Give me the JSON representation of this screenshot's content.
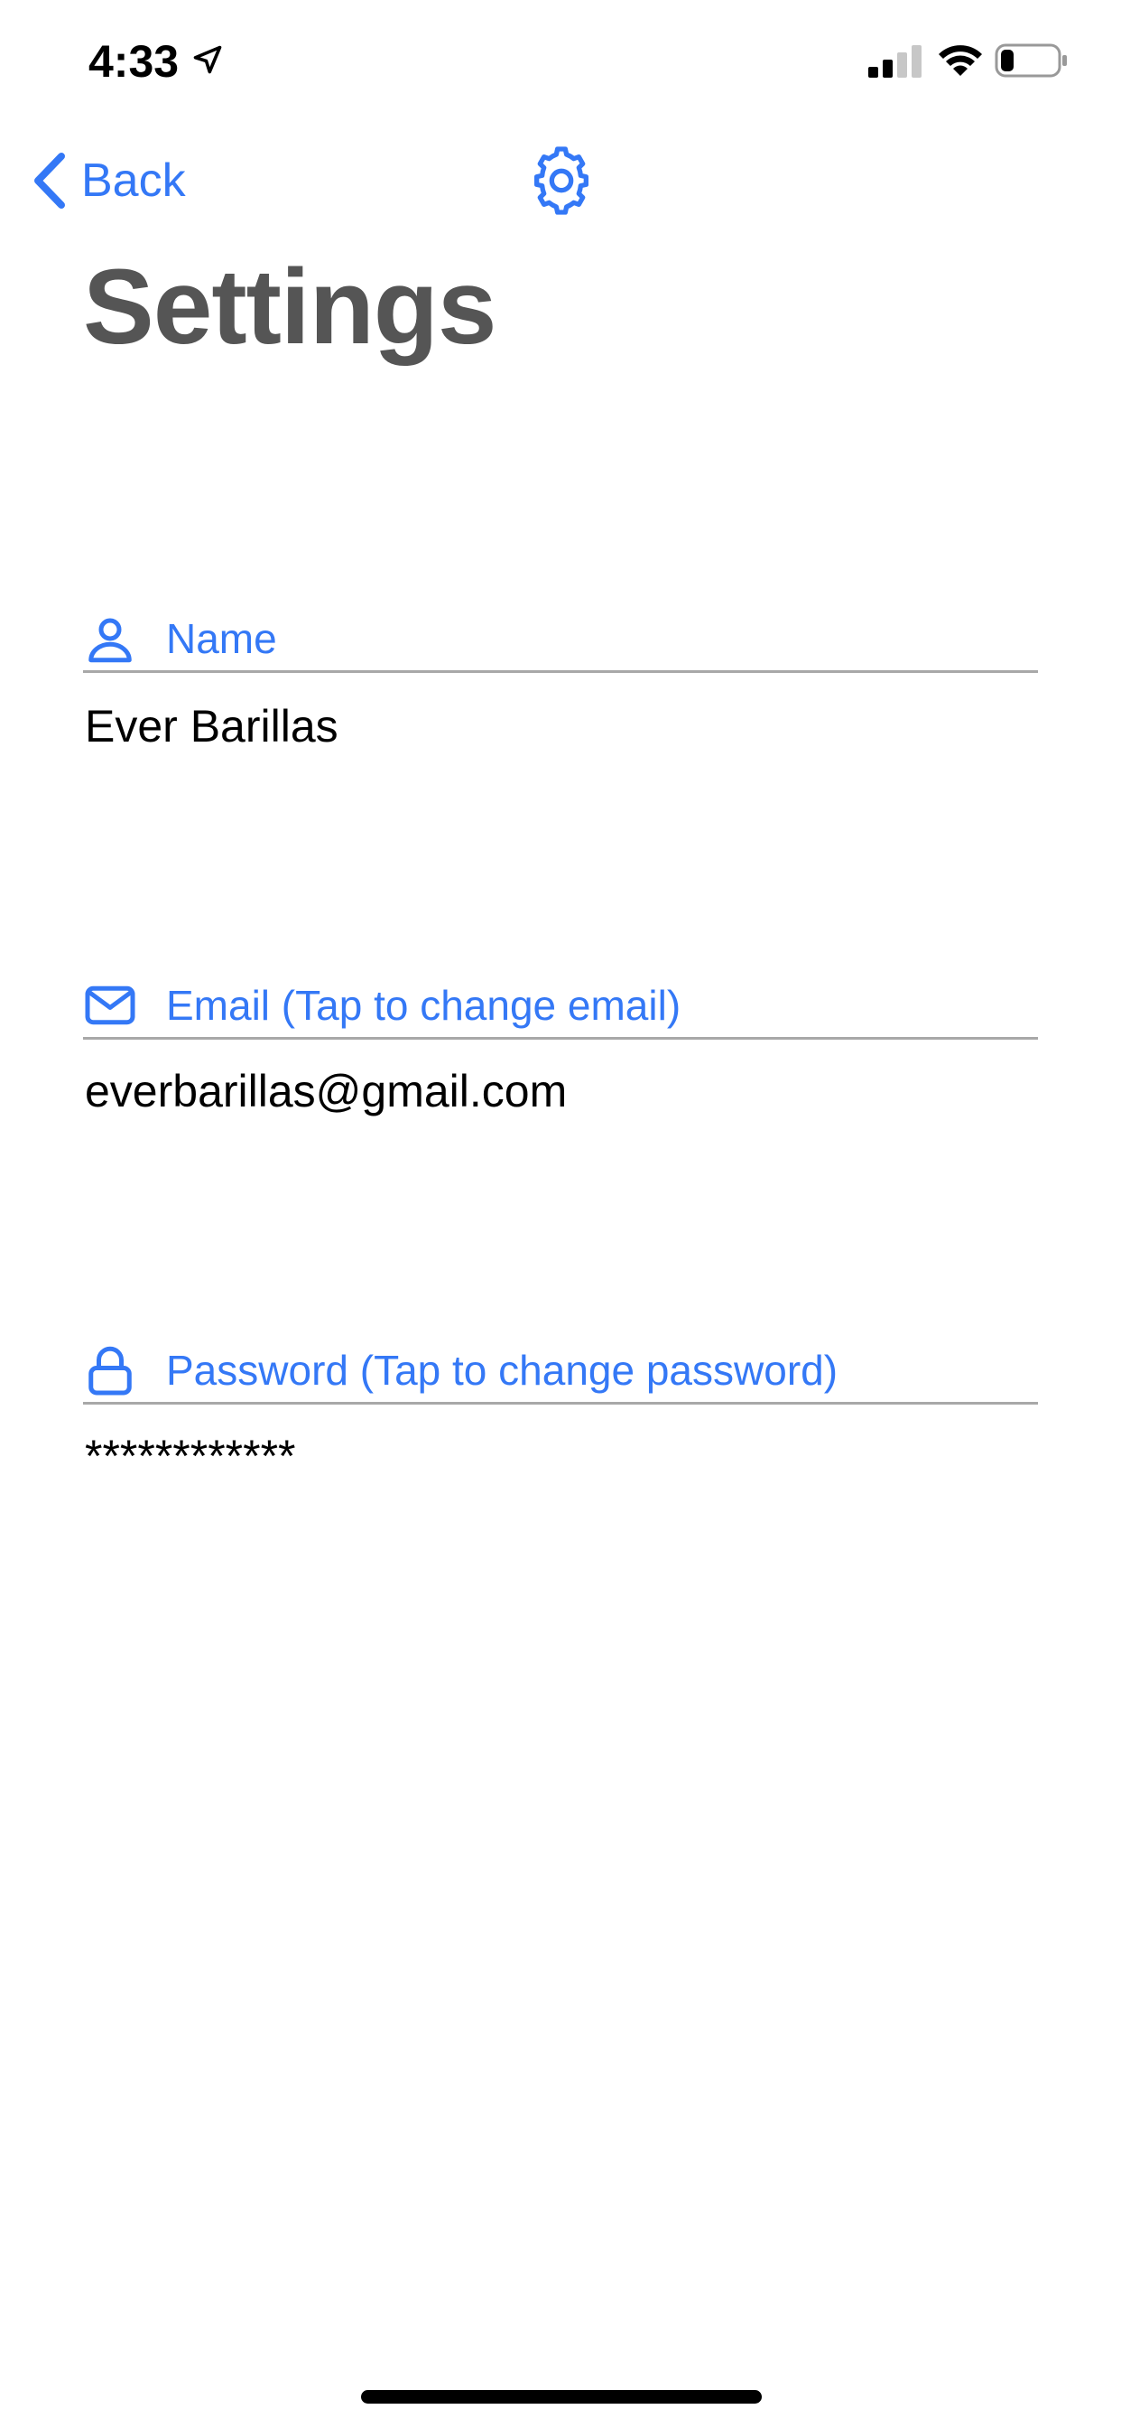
{
  "status_bar": {
    "time": "4:33",
    "icons": [
      "location-arrow-icon",
      "cellular-signal-icon",
      "wifi-icon",
      "battery-icon"
    ],
    "battery_level": 0.2,
    "signal_bars": 2
  },
  "nav": {
    "back_label": "Back",
    "center_icon": "gear-icon"
  },
  "page": {
    "title": "Settings"
  },
  "fields": [
    {
      "icon": "person-icon",
      "label": "Name",
      "value": "Ever Barillas"
    },
    {
      "icon": "envelope-icon",
      "label": "Email (Tap to change email)",
      "value": "everbarillas@gmail.com"
    },
    {
      "icon": "lock-icon",
      "label": "Password (Tap to change password)",
      "value": "************"
    }
  ],
  "colors": {
    "accent": "#3478f6",
    "title": "#555555",
    "divider": "#a8a8a8",
    "text": "#000000"
  }
}
